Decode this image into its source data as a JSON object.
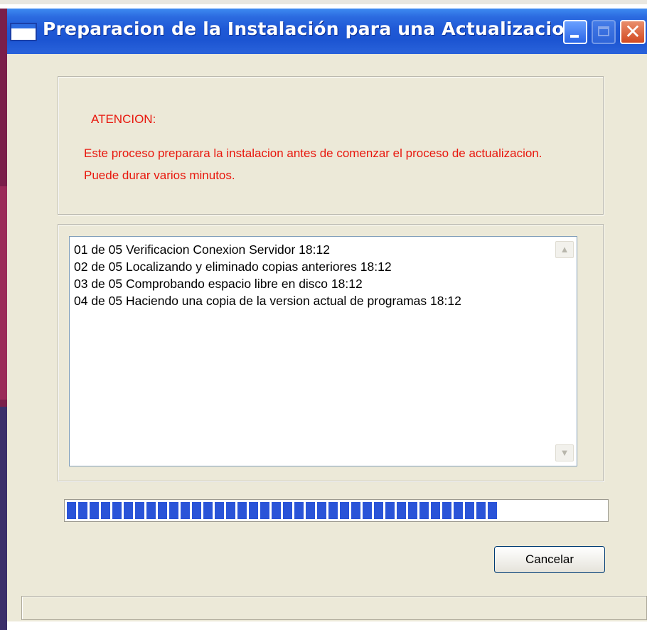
{
  "window": {
    "title": "Preparacion de la Instalación para una Actualizacion"
  },
  "warning": {
    "title": "ATENCION:",
    "message": "Este proceso preparara la instalacion antes de comenzar el proceso de actualizacion. Puede durar varios minutos."
  },
  "log": {
    "lines": [
      "01 de 05 Verificacion Conexion Servidor 18:12",
      "02 de 05 Localizando y eliminado copias anteriores 18:12",
      "03 de 05 Comprobando espacio libre en disco 18:12",
      "04 de 05 Haciendo una copia de la version actual de programas 18:12"
    ]
  },
  "progress": {
    "value_percent": 80
  },
  "buttons": {
    "cancel_label": "Cancelar",
    "close_glyph": "✕"
  },
  "icons": {
    "title": "window-app-icon",
    "minimize": "minimize-icon",
    "maximize": "maximize-icon",
    "close": "close-icon",
    "scroll_up": "scroll-up-arrow-icon",
    "scroll_down": "scroll-down-arrow-icon"
  },
  "colors": {
    "warning_text": "#e8170d",
    "progress_fill": "#2a54d8",
    "title_bar": "#1f59d6"
  }
}
